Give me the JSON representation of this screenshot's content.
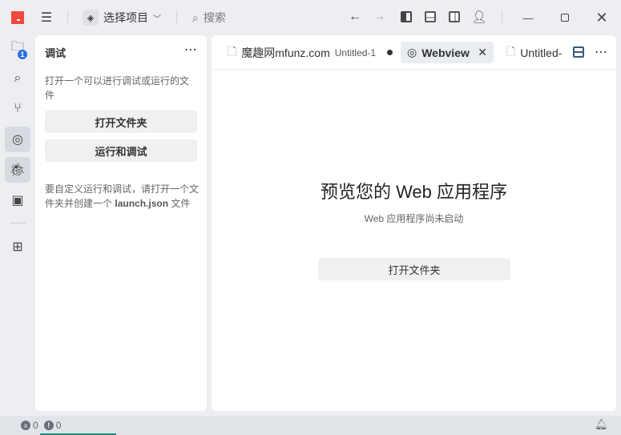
{
  "titlebar": {
    "project": "选择项目",
    "search_placeholder": "搜索"
  },
  "activity": {
    "explorer_badge": "1"
  },
  "sidebar": {
    "title": "调试",
    "description": "打开一个可以进行调试或运行的文件",
    "open_folder": "打开文件夹",
    "run_debug": "运行和调试",
    "hint_prefix": "要自定义运行和调试，请打开一个文件夹并创建一个",
    "hint_file": "launch.json",
    "hint_suffix": "文件"
  },
  "tabs": [
    {
      "label": "魔趣网mfunz.com",
      "detail": "Untitled-1",
      "dirty": true
    },
    {
      "label": "Webview",
      "active": true
    },
    {
      "label": "Untitled-"
    }
  ],
  "webview": {
    "title": "预览您的 Web 应用程序",
    "subtitle": "Web 应用程序尚未启动",
    "open_folder": "打开文件夹"
  },
  "statusbar": {
    "errors": "0",
    "warnings": "0"
  },
  "colors": {
    "logo": "#f0483e",
    "badge": "#2f6fe4",
    "accent_line": "#1e8a7a"
  }
}
